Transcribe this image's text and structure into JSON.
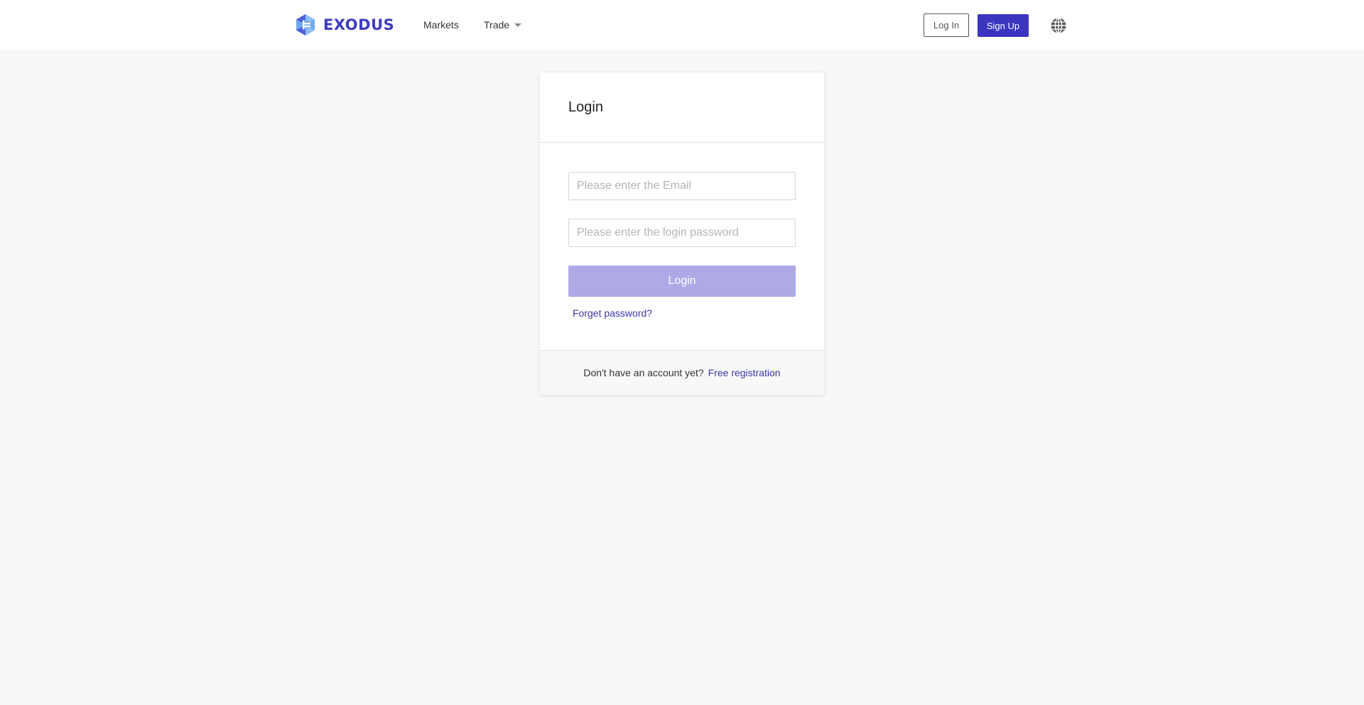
{
  "header": {
    "logo_text": "EXODUS",
    "logo_icon": "exodus-hexagon-logo",
    "nav": {
      "markets": "Markets",
      "trade": "Trade"
    },
    "login_label": "Log In",
    "signup_label": "Sign Up",
    "language_icon": "globe-icon"
  },
  "login_card": {
    "title": "Login",
    "email_placeholder": "Please enter the Email",
    "password_placeholder": "Please enter the login password",
    "submit_label": "Login",
    "forgot_label": "Forget password?",
    "footer_text": "Don't have an account yet?",
    "register_label": "Free registration"
  },
  "colors": {
    "brand": "#3b35bf",
    "link": "#3b35a6",
    "submit_disabled": "#aeaae6",
    "logo_icon_light": "#6fa8ec",
    "logo_icon_dark": "#4b5fd6",
    "page_background": "#f8f8f8"
  }
}
